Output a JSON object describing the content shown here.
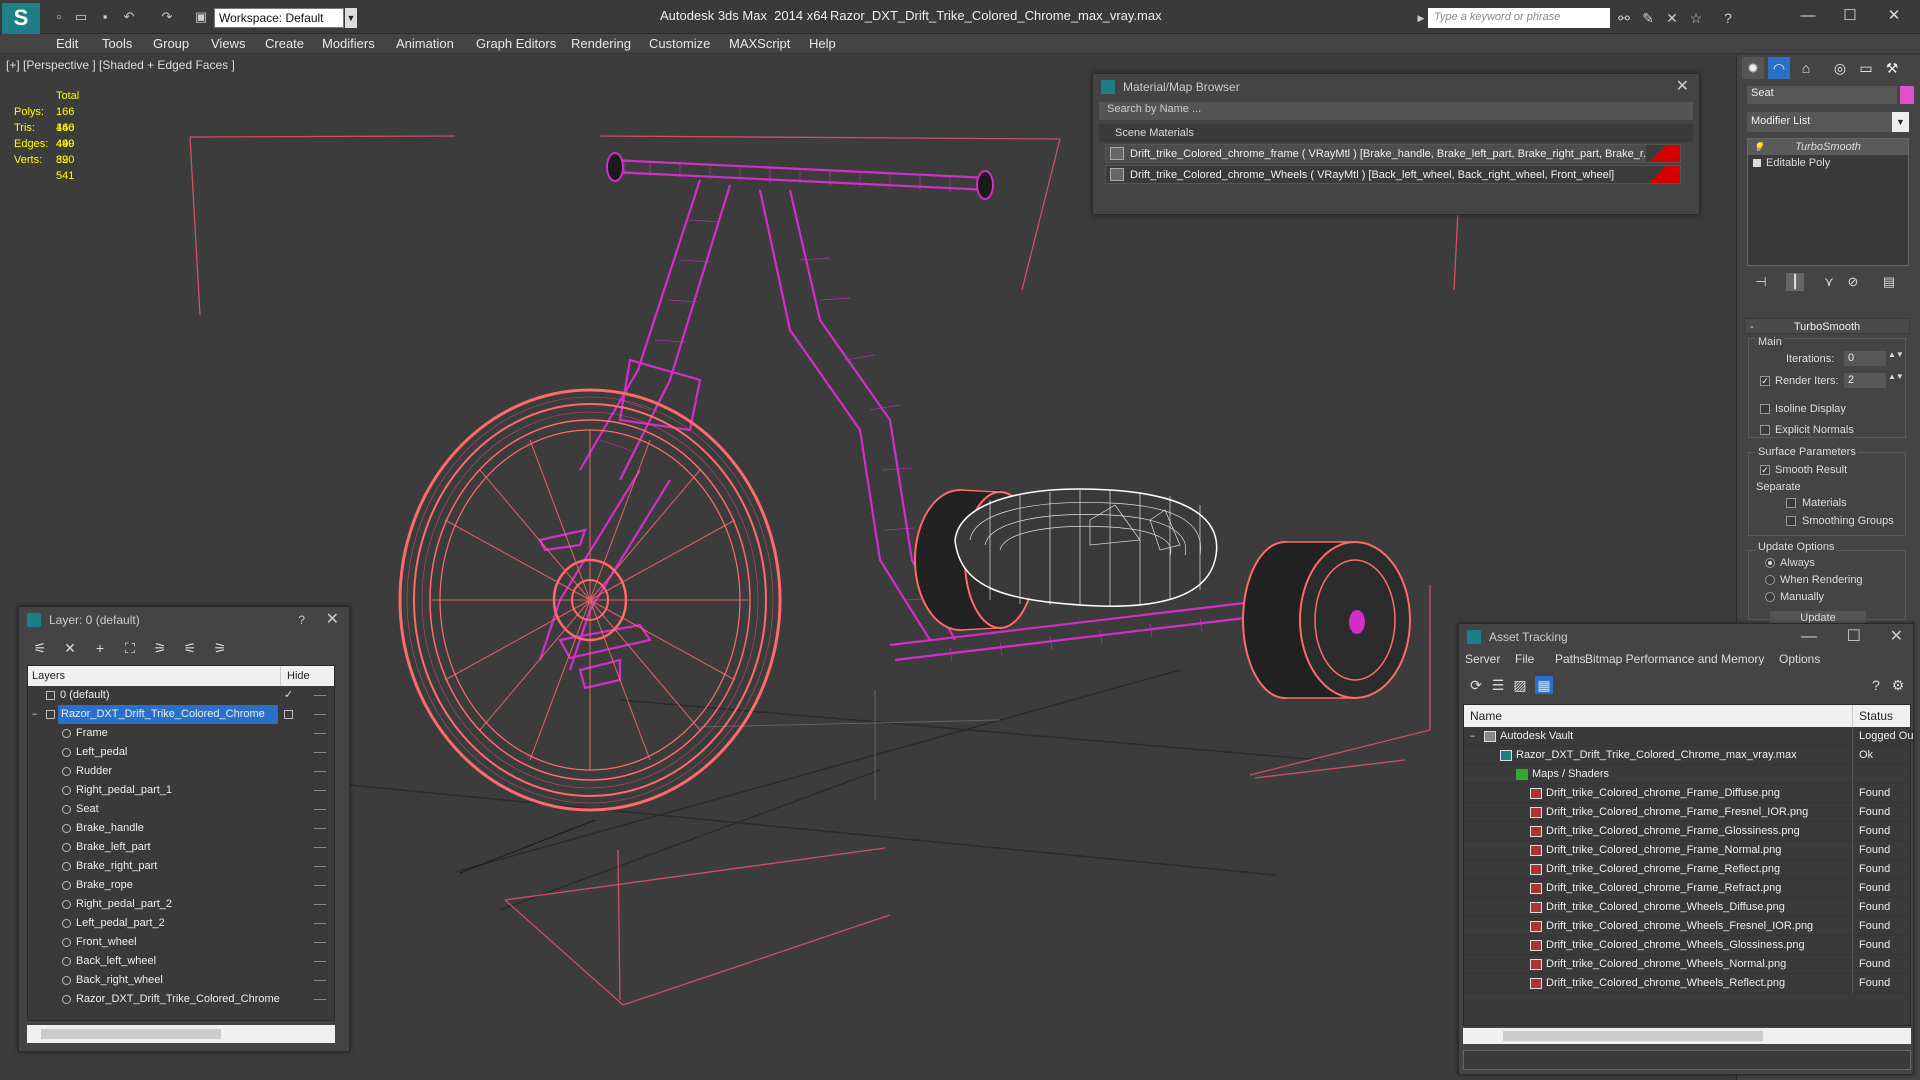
{
  "titlebar": {
    "app_title": "Autodesk 3ds Max  2014 x64",
    "file_title": "Razor_DXT_Drift_Trike_Colored_Chrome_max_vray.max",
    "workspace": "Workspace: Default",
    "search_placeholder": "Type a keyword or phrase"
  },
  "menu": [
    "Edit",
    "Tools",
    "Group",
    "Views",
    "Create",
    "Modifiers",
    "Animation",
    "Graph Editors",
    "Rendering",
    "Customize",
    "MAXScript",
    "Help"
  ],
  "viewport": {
    "label": "[+] [Perspective ] [Shaded + Edged Faces ]",
    "stats": {
      "header": "Total",
      "rows": [
        {
          "label": "Polys:",
          "value": "166 440"
        },
        {
          "label": "Tris:",
          "value": "166 440"
        },
        {
          "label": "Edges:",
          "value": "499 320"
        },
        {
          "label": "Verts:",
          "value": "89 541"
        }
      ]
    },
    "colors": {
      "wire_frame": "#d22fc8",
      "wire_wheel": "#ff6a6a",
      "wire_seat": "#ffffff",
      "box": "#e0506a"
    }
  },
  "material_browser": {
    "title": "Material/Map Browser",
    "search_placeholder": "Search by Name ...",
    "section": "Scene Materials",
    "rows": [
      "Drift_trike_Colored_chrome_frame  ( VRayMtl ) [Brake_handle, Brake_left_part, Brake_right_part, Brake_r...",
      "Drift_trike_Colored_chrome_Wheels  ( VRayMtl ) [Back_left_wheel, Back_right_wheel, Front_wheel]"
    ]
  },
  "command_panel": {
    "object_name": "Seat",
    "modifier_list": "Modifier List",
    "stack": [
      "TurboSmooth",
      "Editable Poly"
    ],
    "rollout_title": "TurboSmooth",
    "main_label": "Main",
    "iterations_label": "Iterations:",
    "iterations_value": "0",
    "render_iters_label": "Render Iters:",
    "render_iters_value": "2",
    "isoline": "Isoline Display",
    "explicit": "Explicit Normals",
    "surface_params": "Surface Parameters",
    "smooth_result": "Smooth Result",
    "separate": "Separate",
    "materials": "Materials",
    "smoothing_groups": "Smoothing Groups",
    "update_options": "Update Options",
    "always": "Always",
    "when_rendering": "When Rendering",
    "manually": "Manually",
    "update_btn": "Update"
  },
  "layer_panel": {
    "title": "Layer: 0 (default)",
    "help": "?",
    "col_layers": "Layers",
    "col_hide": "Hide",
    "rows": [
      {
        "name": "0 (default)",
        "level": 0,
        "selected": false
      },
      {
        "name": "Razor_DXT_Drift_Trike_Colored_Chrome",
        "level": 0,
        "selected": true
      },
      {
        "name": "Frame",
        "level": 1
      },
      {
        "name": "Left_pedal",
        "level": 1
      },
      {
        "name": "Rudder",
        "level": 1
      },
      {
        "name": "Right_pedal_part_1",
        "level": 1
      },
      {
        "name": "Seat",
        "level": 1
      },
      {
        "name": "Brake_handle",
        "level": 1
      },
      {
        "name": "Brake_left_part",
        "level": 1
      },
      {
        "name": "Brake_right_part",
        "level": 1
      },
      {
        "name": "Brake_rope",
        "level": 1
      },
      {
        "name": "Right_pedal_part_2",
        "level": 1
      },
      {
        "name": "Left_pedal_part_2",
        "level": 1
      },
      {
        "name": "Front_wheel",
        "level": 1
      },
      {
        "name": "Back_left_wheel",
        "level": 1
      },
      {
        "name": "Back_right_wheel",
        "level": 1
      },
      {
        "name": "Razor_DXT_Drift_Trike_Colored_Chrome",
        "level": 1
      }
    ]
  },
  "asset_tracking": {
    "title": "Asset Tracking",
    "menu": [
      "Server",
      "File",
      "Paths",
      "Bitmap Performance and Memory",
      "Options"
    ],
    "col_name": "Name",
    "col_status": "Status",
    "rows": [
      {
        "name": "Autodesk Vault",
        "status": "Logged Ou",
        "level": 0
      },
      {
        "name": "Razor_DXT_Drift_Trike_Colored_Chrome_max_vray.max",
        "status": "Ok",
        "level": 1
      },
      {
        "name": "Maps / Shaders",
        "status": "",
        "level": 2
      },
      {
        "name": "Drift_trike_Colored_chrome_Frame_Diffuse.png",
        "status": "Found",
        "level": 3
      },
      {
        "name": "Drift_trike_Colored_chrome_Frame_Fresnel_IOR.png",
        "status": "Found",
        "level": 3
      },
      {
        "name": "Drift_trike_Colored_chrome_Frame_Glossiness.png",
        "status": "Found",
        "level": 3
      },
      {
        "name": "Drift_trike_Colored_chrome_Frame_Normal.png",
        "status": "Found",
        "level": 3
      },
      {
        "name": "Drift_trike_Colored_chrome_Frame_Reflect.png",
        "status": "Found",
        "level": 3
      },
      {
        "name": "Drift_trike_Colored_chrome_Frame_Refract.png",
        "status": "Found",
        "level": 3
      },
      {
        "name": "Drift_trike_Colored_chrome_Wheels_Diffuse.png",
        "status": "Found",
        "level": 3
      },
      {
        "name": "Drift_trike_Colored_chrome_Wheels_Fresnel_IOR.png",
        "status": "Found",
        "level": 3
      },
      {
        "name": "Drift_trike_Colored_chrome_Wheels_Glossiness.png",
        "status": "Found",
        "level": 3
      },
      {
        "name": "Drift_trike_Colored_chrome_Wheels_Normal.png",
        "status": "Found",
        "level": 3
      },
      {
        "name": "Drift_trike_Colored_chrome_Wheels_Reflect.png",
        "status": "Found",
        "level": 3
      }
    ]
  }
}
